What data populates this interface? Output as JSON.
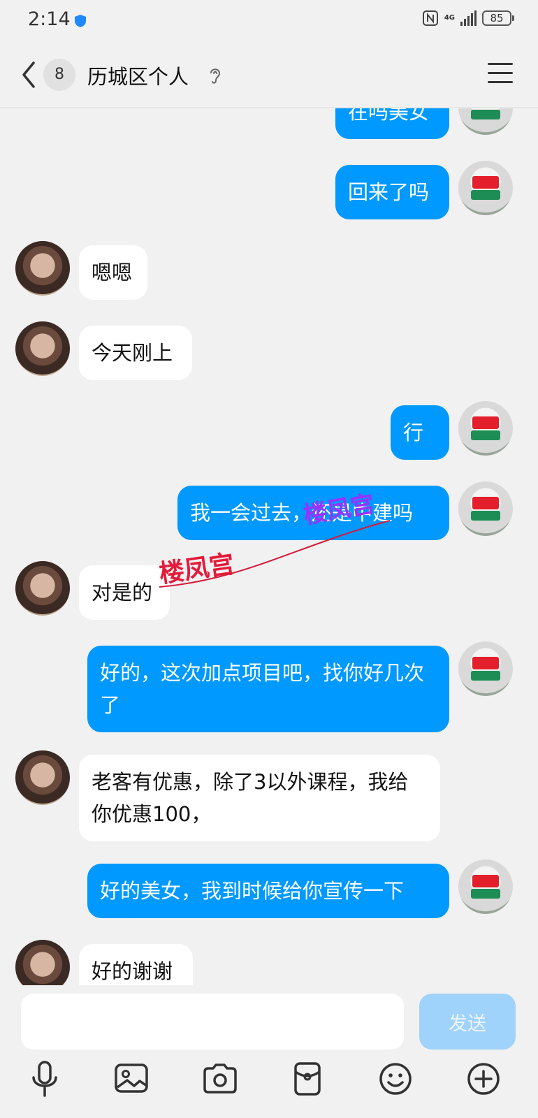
{
  "status_bar": {
    "time": "2:14",
    "network": "4G",
    "battery": "85"
  },
  "header": {
    "unread_count": "8",
    "title": "历城区个人"
  },
  "messages": [
    {
      "side": "right",
      "text": "在吗美女"
    },
    {
      "side": "right",
      "text": "回来了吗"
    },
    {
      "side": "left",
      "text": "嗯嗯"
    },
    {
      "side": "left",
      "text": "今天刚上"
    },
    {
      "side": "right",
      "text": "行"
    },
    {
      "side": "right",
      "text": "我一会过去，还是中建吗"
    },
    {
      "side": "left",
      "text": "对是的"
    },
    {
      "side": "right",
      "text": "好的，这次加点项目吧，找你好几次了"
    },
    {
      "side": "left",
      "text": "老客有优惠，除了3以外课程，我给你优惠100，"
    },
    {
      "side": "right",
      "text": "好的美女，我到时候给你宣传一下"
    },
    {
      "side": "left",
      "text": "好的谢谢"
    }
  ],
  "watermarks": [
    "楼凤宫",
    "楼凤宫"
  ],
  "input": {
    "placeholder": "",
    "send_label": "发送"
  },
  "toolbar": [
    "microphone-icon",
    "image-icon",
    "camera-icon",
    "red-packet-icon",
    "emoji-icon",
    "plus-icon"
  ]
}
